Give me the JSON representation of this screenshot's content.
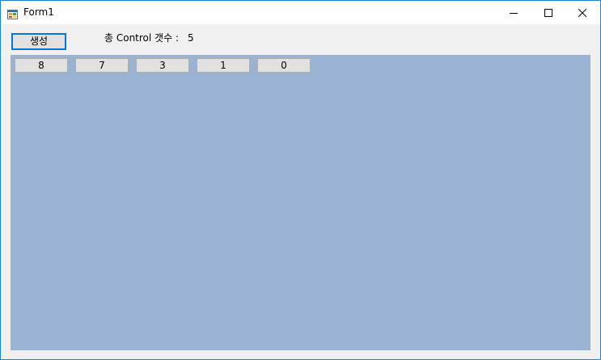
{
  "window": {
    "title": "Form1",
    "icon": "winforms-app-icon",
    "controls": {
      "minimize_icon": "minimize-icon",
      "maximize_icon": "maximize-icon",
      "close_icon": "close-icon"
    }
  },
  "toolbar": {
    "create_label": "생성",
    "count_label": "총 Control 갯수 :",
    "count_value": "5"
  },
  "panel": {
    "background": "#9ab3d2",
    "buttons": [
      {
        "label": "8"
      },
      {
        "label": "7"
      },
      {
        "label": "3"
      },
      {
        "label": "1"
      },
      {
        "label": "0"
      }
    ]
  },
  "colors": {
    "window_border": "#1883d7",
    "focus_border": "#0078d7",
    "button_face": "#e1e1e1",
    "form_background": "#f0f0f0"
  }
}
